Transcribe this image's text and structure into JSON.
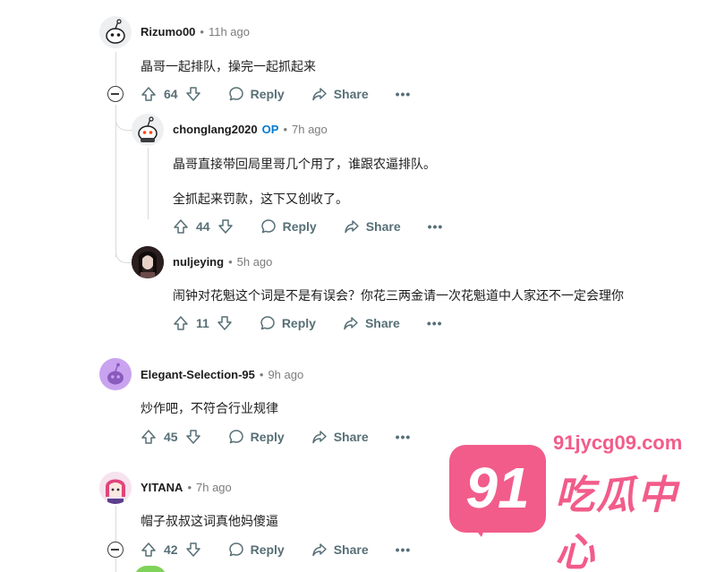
{
  "comments": [
    {
      "username": "Rizumo00",
      "op": "",
      "time": "11h ago",
      "body": [
        "晶哥一起排队，操完一起抓起来"
      ],
      "votes": "64",
      "reply_label": "Reply",
      "share_label": "Share",
      "more": "•••",
      "avatar_color": "#e9ecee"
    },
    {
      "username": "chonglang2020",
      "op": "OP",
      "time": "7h ago",
      "body": [
        "晶哥直接带回局里哥几个用了，谁跟农逼排队。",
        "全抓起来罚款，这下又创收了。"
      ],
      "votes": "44",
      "reply_label": "Reply",
      "share_label": "Share",
      "more": "•••",
      "avatar_color": "#e9ecee"
    },
    {
      "username": "nuljeying",
      "op": "",
      "time": "5h ago",
      "body": [
        "闹钟对花魁这个词是不是有误会？你花三两金请一次花魁道中人家还不一定会理你"
      ],
      "votes": "11",
      "reply_label": "Reply",
      "share_label": "Share",
      "more": "•••",
      "avatar_color": "#3b2a2a"
    },
    {
      "username": "Elegant-Selection-95",
      "op": "",
      "time": "9h ago",
      "body": [
        "炒作吧，不符合行业规律"
      ],
      "votes": "45",
      "reply_label": "Reply",
      "share_label": "Share",
      "more": "•••",
      "avatar_color": "#c9a3f0"
    },
    {
      "username": "YITANA",
      "op": "",
      "time": "7h ago",
      "body": [
        "帽子叔叔这词真他妈傻逼"
      ],
      "votes": "42",
      "reply_label": "Reply",
      "share_label": "Share",
      "more": "•••",
      "avatar_color": "#f3d6e6"
    }
  ],
  "separator": "•",
  "watermark": {
    "number": "91",
    "url": "91jycg09.com",
    "name": "吃瓜中心",
    "color": "#f25c8a"
  }
}
